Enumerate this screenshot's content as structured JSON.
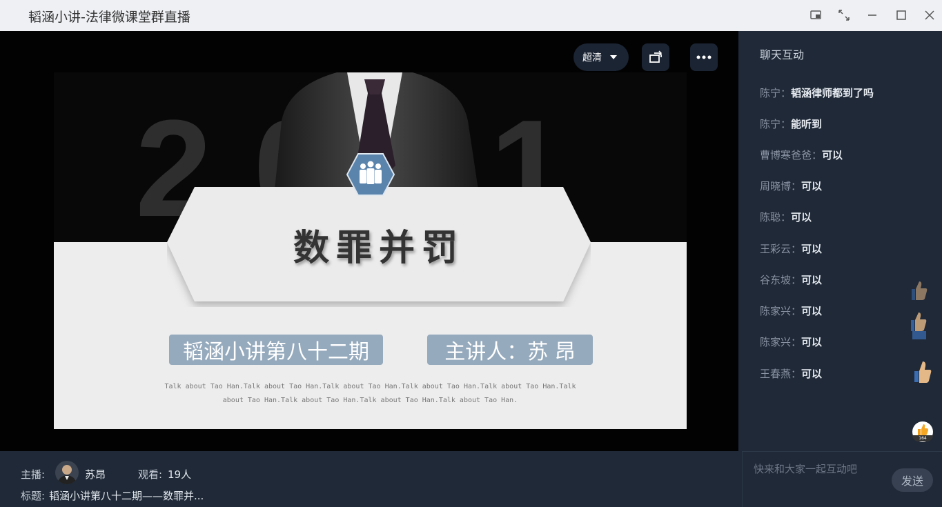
{
  "window": {
    "title": "韬涵小讲-法律微课堂群直播"
  },
  "player": {
    "quality_label": "超清"
  },
  "slide": {
    "year": "2021",
    "title": "数罪并罚",
    "episode": "韬涵小讲第八十二期",
    "speaker": "主讲人：苏 昂",
    "tagline": "Talk about Tao Han.Talk about Tao Han.Talk about Tao Han.Talk about Tao Han.Talk about Tao Han.Talk about Tao Han.Talk about Tao Han.Talk about Tao Han.Talk about Tao Han."
  },
  "chat": {
    "heading": "聊天互动",
    "messages": [
      {
        "user": "陈宁：",
        "text": "韬涵律师都到了吗"
      },
      {
        "user": "陈宁：",
        "text": "能听到"
      },
      {
        "user": "曹博寒爸爸：",
        "text": "可以"
      },
      {
        "user": "周晓博：",
        "text": "可以"
      },
      {
        "user": "陈聪：",
        "text": "可以"
      },
      {
        "user": "王彩云：",
        "text": "可以"
      },
      {
        "user": "谷东坡：",
        "text": "可以"
      },
      {
        "user": "陈家兴：",
        "text": "可以"
      },
      {
        "user": "陈家兴：",
        "text": "可以"
      },
      {
        "user": "王春燕：",
        "text": "可以"
      }
    ],
    "like_count": "164",
    "input_placeholder": "快来和大家一起互动吧",
    "send_label": "发送"
  },
  "footer": {
    "host_label": "主播:",
    "host_name": "苏昂",
    "viewers_label": "观看:",
    "viewers_value": "19人",
    "topic_label": "标题:",
    "topic_value": "韬涵小讲第八十二期——数罪并..."
  },
  "colors": {
    "accent_hex": "#5b84ad",
    "pill": "#96aabd",
    "panel": "#1f2937"
  }
}
